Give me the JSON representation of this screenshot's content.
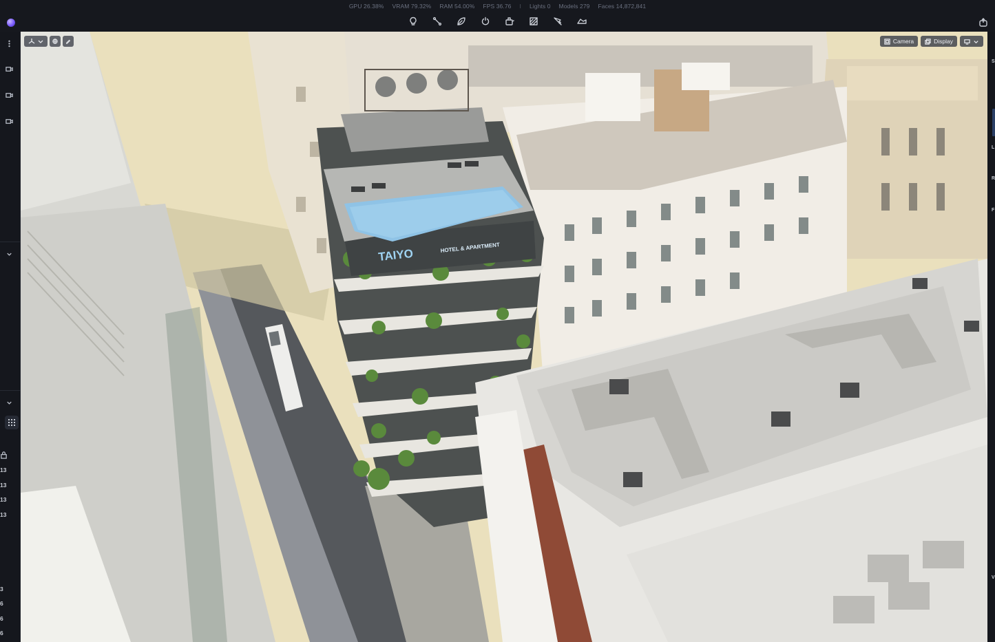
{
  "stats": {
    "gpu": "GPU 26.38%",
    "vram": "VRAM 79.32%",
    "ram": "RAM 54.00%",
    "fps": "FPS 36.76",
    "separator": "I",
    "lights": "Lights 0",
    "models": "Models 279",
    "faces": "Faces 14,872,841"
  },
  "toolbar": {
    "tools": [
      "light-bulb-icon",
      "path-icon",
      "leaf-icon",
      "power-icon",
      "camera-rig-icon",
      "material-icon",
      "pen-icon",
      "terrain-icon"
    ]
  },
  "left_rail": {
    "numbers": [
      "13",
      "13",
      "13",
      "13"
    ],
    "bottom_numbers": [
      "3",
      "6",
      "6",
      "6"
    ]
  },
  "viewport": {
    "camera_label": "Camera",
    "display_label": "Display",
    "sign_brand": "TAIYO",
    "sign_sub": "HOTEL & APARTMENT"
  },
  "right_rail": {
    "letters": [
      "S",
      "L",
      "R",
      "F",
      "V"
    ]
  },
  "colors": {
    "ui_bg": "#15171d",
    "ground": "#e9dfba",
    "pool": "#8fc3e6"
  }
}
